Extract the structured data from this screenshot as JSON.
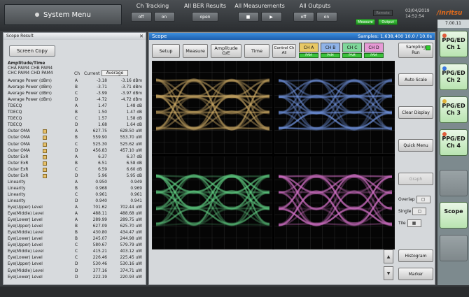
{
  "topbar": {
    "system_menu": "System Menu",
    "ch_tracking": {
      "label": "Ch Tracking",
      "buttons": [
        "off",
        "on"
      ]
    },
    "all_ber": {
      "label": "All BER Results",
      "buttons": [
        "open"
      ]
    },
    "all_meas": {
      "label": "All Measurements",
      "buttons": [
        "■",
        "▶"
      ]
    },
    "all_outputs": {
      "label": "All Outputs",
      "buttons": [
        "off",
        "on"
      ]
    },
    "status": {
      "remote": "Remote",
      "measure": "Measure",
      "output": "Output"
    },
    "date": "03/04/2019",
    "time": "14:52:54",
    "logo": "/inritsu"
  },
  "scope_result": {
    "title": "Scope Result",
    "screen_copy": "Screen Copy",
    "amplitude_time": "Amplitude/Time",
    "legend_line1": "CHA PAM4   CHB PAM4",
    "legend_line2": "CHC PAM4   CHD PAM4",
    "col_ch": "Ch",
    "col_current": "Current",
    "average_btn": "Average",
    "rows": [
      {
        "m": "Average Power (dBm)",
        "c": "A",
        "cur": "-3.18",
        "av": "-3.16 dBm"
      },
      {
        "m": "Average Power (dBm)",
        "c": "B",
        "cur": "-3.71",
        "av": "-3.71 dBm"
      },
      {
        "m": "Average Power (dBm)",
        "c": "C",
        "cur": "-3.99",
        "av": "-3.97 dBm"
      },
      {
        "m": "Average Power (dBm)",
        "c": "D",
        "cur": "-4.72",
        "av": "-4.72 dBm"
      },
      {
        "m": "TDECQ",
        "c": "A",
        "cur": "1.47",
        "av": "1.48 dB"
      },
      {
        "m": "TDECQ",
        "c": "B",
        "cur": "1.50",
        "av": "1.47 dB"
      },
      {
        "m": "TDECQ",
        "c": "C",
        "cur": "1.57",
        "av": "1.58 dB"
      },
      {
        "m": "TDECQ",
        "c": "D",
        "cur": "1.68",
        "av": "1.64 dB"
      },
      {
        "m": "Outer OMA",
        "c": "A",
        "cur": "627.75",
        "av": "628.50 uW",
        "g": true
      },
      {
        "m": "Outer OMA",
        "c": "B",
        "cur": "559.90",
        "av": "553.70 uW",
        "g": true
      },
      {
        "m": "Outer OMA",
        "c": "C",
        "cur": "525.30",
        "av": "525.62 uW",
        "g": true
      },
      {
        "m": "Outer OMA",
        "c": "D",
        "cur": "456.83",
        "av": "457.10 uW",
        "g": true
      },
      {
        "m": "Outer ExR",
        "c": "A",
        "cur": "6.37",
        "av": "6.37 dB",
        "g": true
      },
      {
        "m": "Outer ExR",
        "c": "B",
        "cur": "6.51",
        "av": "6.58 dB",
        "g": true
      },
      {
        "m": "Outer ExR",
        "c": "C",
        "cur": "6.59",
        "av": "6.60 dB",
        "g": true
      },
      {
        "m": "Outer ExR",
        "c": "D",
        "cur": "5.96",
        "av": "5.95 dB",
        "g": true
      },
      {
        "m": "Linearity",
        "c": "A",
        "cur": "0.950",
        "av": "0.949"
      },
      {
        "m": "Linearity",
        "c": "B",
        "cur": "0.968",
        "av": "0.969"
      },
      {
        "m": "Linearity",
        "c": "C",
        "cur": "0.961",
        "av": "0.961"
      },
      {
        "m": "Linearity",
        "c": "D",
        "cur": "0.940",
        "av": "0.941"
      },
      {
        "m": "Eye(Upper) Level",
        "c": "A",
        "cur": "701.62",
        "av": "702.44 uW"
      },
      {
        "m": "Eye(Middle) Level",
        "c": "A",
        "cur": "488.11",
        "av": "488.68 uW"
      },
      {
        "m": "Eye(Lower) Level",
        "c": "A",
        "cur": "289.99",
        "av": "289.75 uW"
      },
      {
        "m": "Eye(Upper) Level",
        "c": "B",
        "cur": "627.09",
        "av": "625.70 uW"
      },
      {
        "m": "Eye(Middle) Level",
        "c": "B",
        "cur": "430.80",
        "av": "434.47 uW"
      },
      {
        "m": "Eye(Lower) Level",
        "c": "B",
        "cur": "245.07",
        "av": "244.98 uW"
      },
      {
        "m": "Eye(Upper) Level",
        "c": "C",
        "cur": "580.67",
        "av": "579.79 uW"
      },
      {
        "m": "Eye(Middle) Level",
        "c": "C",
        "cur": "415.21",
        "av": "403.12 uW"
      },
      {
        "m": "Eye(Lower) Level",
        "c": "C",
        "cur": "226.46",
        "av": "225.45 uW"
      },
      {
        "m": "Eye(Upper) Level",
        "c": "D",
        "cur": "530.46",
        "av": "530.16 uW"
      },
      {
        "m": "Eye(Middle) Level",
        "c": "D",
        "cur": "377.16",
        "av": "374.71 uW"
      },
      {
        "m": "Eye(Lower) Level",
        "c": "D",
        "cur": "222.19",
        "av": "220.93 uW"
      }
    ]
  },
  "scope": {
    "title": "Scope",
    "samples": "Samples: 1,638,400",
    "rate": "10.0 / 10.0s",
    "setup": "Setup",
    "measure": "Measure",
    "amplitude_line1": "Amplitude",
    "amplitude_line2": "O/E",
    "time": "Time",
    "control_ch": "Control Ch",
    "control_all": "All",
    "channels": [
      {
        "label": "CH A",
        "color": "#e8c865",
        "eye": "#c9a862"
      },
      {
        "label": "CH B",
        "color": "#8fb3e8",
        "eye": "#6f8fd8"
      },
      {
        "label": "CH C",
        "color": "#7fd79a",
        "eye": "#5fc67e"
      },
      {
        "label": "CH D",
        "color": "#e79ad6",
        "eye": "#cf6fc0"
      }
    ],
    "ch_sub": "PAM",
    "sampling_line1": "Sampling",
    "sampling_line2": "Run",
    "auto_scale": "Auto Scale",
    "clear_display": "Clear Display",
    "quick_menu": "Quick Menu",
    "graph": "Graph",
    "overlap": "Overlap",
    "single": "Single",
    "tile": "Tile",
    "histogram": "Histogram",
    "marker": "Marker"
  },
  "right_panel": {
    "version": "7.00.11",
    "buttons": [
      {
        "line1": "PPG/ED",
        "line2": "Ch 1",
        "dot": "#e05b3a"
      },
      {
        "line1": "PPG/ED",
        "line2": "Ch 2",
        "dot": "#3a78e0"
      },
      {
        "line1": "PPG/ED",
        "line2": "Ch 3",
        "dot": "#e0b23a"
      },
      {
        "line1": "PPG/ED",
        "line2": "Ch 4",
        "dot": "#e05b3a"
      }
    ],
    "scope": "Scope"
  }
}
